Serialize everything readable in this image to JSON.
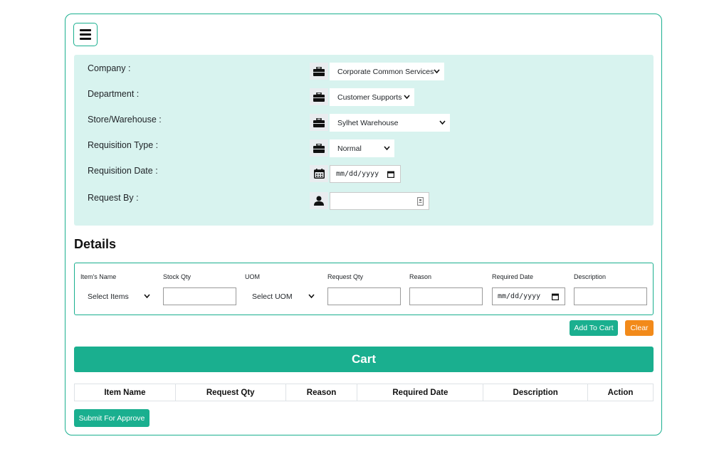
{
  "form": {
    "rows": [
      {
        "label": "Company :",
        "icon": "briefcase-icon",
        "value": "Corporate Common Services"
      },
      {
        "label": "Department :",
        "icon": "briefcase-icon",
        "value": "Customer Supports"
      },
      {
        "label": "Store/Warehouse :",
        "icon": "briefcase-icon",
        "value": "Sylhet Warehouse"
      },
      {
        "label": "Requisition Type :",
        "icon": "briefcase-icon",
        "value": "Normal"
      },
      {
        "label": "Requisition Date :",
        "icon": "calendar-icon",
        "value": "mm/dd/yyyy"
      },
      {
        "label": "Request By :",
        "icon": "user-icon",
        "value": ""
      }
    ]
  },
  "details": {
    "title": "Details",
    "columns": [
      {
        "label": "Item's Name",
        "value": "Select Items",
        "type": "select"
      },
      {
        "label": "Stock Qty",
        "value": "",
        "type": "input"
      },
      {
        "label": "UOM",
        "value": "Select UOM",
        "type": "select"
      },
      {
        "label": "Request Qty",
        "value": "",
        "type": "input"
      },
      {
        "label": "Reason",
        "value": "",
        "type": "input"
      },
      {
        "label": "Required Date",
        "value": "mm/dd/yyyy",
        "type": "date"
      },
      {
        "label": "Description",
        "value": "",
        "type": "input"
      }
    ],
    "add_label": "Add To Cart",
    "clear_label": "Clear"
  },
  "cart": {
    "title": "Cart",
    "headers": [
      "Item Name",
      "Request Qty",
      "Reason",
      "Required Date",
      "Description",
      "Action"
    ]
  },
  "submit_label": "Submit For Approve",
  "colors": {
    "accent": "#1aaf8f",
    "warning": "#f28a1a",
    "panel": "#d8f3ef"
  }
}
